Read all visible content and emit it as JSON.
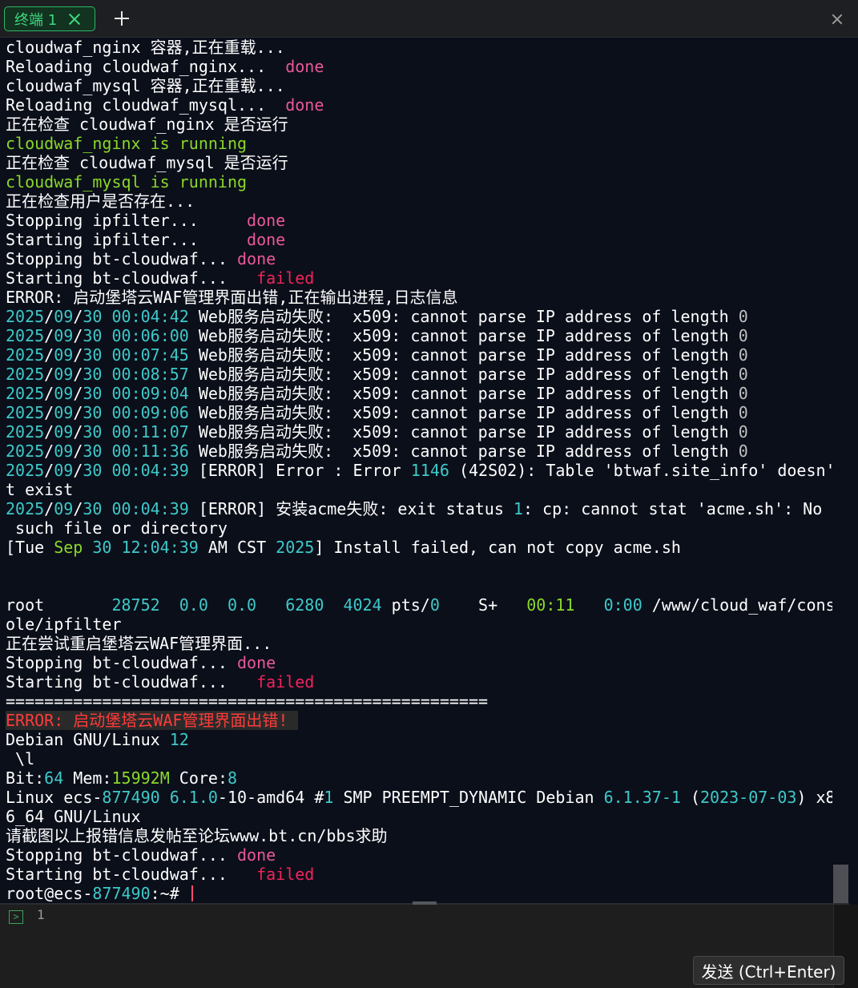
{
  "colors": {
    "default": "#ffffff",
    "done": "#e8589a",
    "failed": "#f0245a",
    "ok_green": "#8ad82a",
    "cyan": "#3ec9c9",
    "gray": "#bfbfbf",
    "red": "#ff3b3b"
  },
  "tabbar": {
    "tab_label": "终端 1",
    "close_icon": "close-icon",
    "add_icon": "plus-icon",
    "window_close_icon": "close-icon"
  },
  "terminal": {
    "lines": [
      [
        [
          "cloudwaf_nginx 容器,正在重载...",
          "default"
        ]
      ],
      [
        [
          "Reloading cloudwaf_nginx...  ",
          "default"
        ],
        [
          "done",
          "done"
        ]
      ],
      [
        [
          "cloudwaf_mysql 容器,正在重载...",
          "default"
        ]
      ],
      [
        [
          "Reloading cloudwaf_mysql...  ",
          "default"
        ],
        [
          "done",
          "done"
        ]
      ],
      [
        [
          "正在检查 cloudwaf_nginx 是否运行",
          "default"
        ]
      ],
      [
        [
          "cloudwaf_nginx is running",
          "ok_green"
        ]
      ],
      [
        [
          "正在检查 cloudwaf_mysql 是否运行",
          "default"
        ]
      ],
      [
        [
          "cloudwaf_mysql is running",
          "ok_green"
        ]
      ],
      [
        [
          "正在检查用户是否存在...",
          "default"
        ]
      ],
      [
        [
          "Stopping ipfilter...     ",
          "default"
        ],
        [
          "done",
          "done"
        ]
      ],
      [
        [
          "Starting ipfilter...     ",
          "default"
        ],
        [
          "done",
          "done"
        ]
      ],
      [
        [
          "Stopping bt-cloudwaf... ",
          "default"
        ],
        [
          "done",
          "done"
        ]
      ],
      [
        [
          "Starting bt-cloudwaf...   ",
          "default"
        ],
        [
          "failed",
          "failed"
        ]
      ],
      [
        [
          "ERROR: 启动堡塔云WAF管理界面出错,正在输出进程,日志信息",
          "default"
        ]
      ],
      [
        [
          "2025",
          "cyan"
        ],
        [
          "/",
          "default"
        ],
        [
          "09",
          "cyan"
        ],
        [
          "/",
          "default"
        ],
        [
          "30 00:04:42",
          "cyan"
        ],
        [
          " Web服务启动失败:  x509: cannot parse IP address of length ",
          "default"
        ],
        [
          "0",
          "gray"
        ]
      ],
      [
        [
          "2025",
          "cyan"
        ],
        [
          "/",
          "default"
        ],
        [
          "09",
          "cyan"
        ],
        [
          "/",
          "default"
        ],
        [
          "30 00:06:00",
          "cyan"
        ],
        [
          " Web服务启动失败:  x509: cannot parse IP address of length ",
          "default"
        ],
        [
          "0",
          "gray"
        ]
      ],
      [
        [
          "2025",
          "cyan"
        ],
        [
          "/",
          "default"
        ],
        [
          "09",
          "cyan"
        ],
        [
          "/",
          "default"
        ],
        [
          "30 00:07:45",
          "cyan"
        ],
        [
          " Web服务启动失败:  x509: cannot parse IP address of length ",
          "default"
        ],
        [
          "0",
          "gray"
        ]
      ],
      [
        [
          "2025",
          "cyan"
        ],
        [
          "/",
          "default"
        ],
        [
          "09",
          "cyan"
        ],
        [
          "/",
          "default"
        ],
        [
          "30 00:08:57",
          "cyan"
        ],
        [
          " Web服务启动失败:  x509: cannot parse IP address of length ",
          "default"
        ],
        [
          "0",
          "gray"
        ]
      ],
      [
        [
          "2025",
          "cyan"
        ],
        [
          "/",
          "default"
        ],
        [
          "09",
          "cyan"
        ],
        [
          "/",
          "default"
        ],
        [
          "30 00:09:04",
          "cyan"
        ],
        [
          " Web服务启动失败:  x509: cannot parse IP address of length ",
          "default"
        ],
        [
          "0",
          "gray"
        ]
      ],
      [
        [
          "2025",
          "cyan"
        ],
        [
          "/",
          "default"
        ],
        [
          "09",
          "cyan"
        ],
        [
          "/",
          "default"
        ],
        [
          "30 00:09:06",
          "cyan"
        ],
        [
          " Web服务启动失败:  x509: cannot parse IP address of length ",
          "default"
        ],
        [
          "0",
          "gray"
        ]
      ],
      [
        [
          "2025",
          "cyan"
        ],
        [
          "/",
          "default"
        ],
        [
          "09",
          "cyan"
        ],
        [
          "/",
          "default"
        ],
        [
          "30 00:11:07",
          "cyan"
        ],
        [
          " Web服务启动失败:  x509: cannot parse IP address of length ",
          "default"
        ],
        [
          "0",
          "gray"
        ]
      ],
      [
        [
          "2025",
          "cyan"
        ],
        [
          "/",
          "default"
        ],
        [
          "09",
          "cyan"
        ],
        [
          "/",
          "default"
        ],
        [
          "30 00:11:36",
          "cyan"
        ],
        [
          " Web服务启动失败:  x509: cannot parse IP address of length ",
          "default"
        ],
        [
          "0",
          "gray"
        ]
      ],
      [
        [
          "2025",
          "cyan"
        ],
        [
          "/",
          "default"
        ],
        [
          "09",
          "cyan"
        ],
        [
          "/",
          "default"
        ],
        [
          "30 00:04:39",
          "cyan"
        ],
        [
          " [ERROR] Error : Error ",
          "default"
        ],
        [
          "1146",
          "cyan"
        ],
        [
          " (42S02): Table 'btwaf.site_info' doesn'",
          "default"
        ]
      ],
      [
        [
          "t exist",
          "default"
        ]
      ],
      [
        [
          "2025",
          "cyan"
        ],
        [
          "/",
          "default"
        ],
        [
          "09",
          "cyan"
        ],
        [
          "/",
          "default"
        ],
        [
          "30 00:04:39",
          "cyan"
        ],
        [
          " [ERROR] 安装acme失败: exit status ",
          "default"
        ],
        [
          "1",
          "cyan"
        ],
        [
          ": cp: cannot stat 'acme.sh': No",
          "default"
        ]
      ],
      [
        [
          " such file or directory",
          "default"
        ]
      ],
      [
        [
          "[Tue ",
          "default"
        ],
        [
          "Sep",
          "ok_green"
        ],
        [
          " ",
          "default"
        ],
        [
          "30 12:04:39",
          "cyan"
        ],
        [
          " AM CST ",
          "default"
        ],
        [
          "2025",
          "cyan"
        ],
        [
          "] Install failed, can not copy acme.sh",
          "default"
        ]
      ],
      [],
      [],
      [
        [
          "root       ",
          "default"
        ],
        [
          "28752  0.0  0.0   6280  4024",
          "cyan"
        ],
        [
          " pts/",
          "default"
        ],
        [
          "0",
          "cyan"
        ],
        [
          "    S+   ",
          "default"
        ],
        [
          "00:11",
          "ok_green"
        ],
        [
          "   ",
          "default"
        ],
        [
          "0:00",
          "cyan"
        ],
        [
          " /www/cloud_waf/cons",
          "default"
        ]
      ],
      [
        [
          "ole/ipfilter",
          "default"
        ]
      ],
      [
        [
          "正在尝试重启堡塔云WAF管理界面...",
          "default"
        ]
      ],
      [
        [
          "Stopping bt-cloudwaf... ",
          "default"
        ],
        [
          "done",
          "done"
        ]
      ],
      [
        [
          "Starting bt-cloudwaf...   ",
          "default"
        ],
        [
          "failed",
          "failed"
        ]
      ],
      [
        [
          "==================================================",
          "default"
        ]
      ],
      [
        [
          "ERROR: 启动堡塔云WAF管理界面出错! ",
          "red",
          true
        ]
      ],
      [
        [
          "Debian GNU/Linux ",
          "default"
        ],
        [
          "12",
          "cyan"
        ]
      ],
      [
        [
          " \\l",
          "default"
        ]
      ],
      [
        [
          "Bit:",
          "default"
        ],
        [
          "64",
          "cyan"
        ],
        [
          " Mem:",
          "default"
        ],
        [
          "15992M",
          "ok_green"
        ],
        [
          " Core:",
          "default"
        ],
        [
          "8",
          "cyan"
        ]
      ],
      [
        [
          "Linux ecs-",
          "default"
        ],
        [
          "877490 6.1.0",
          "cyan"
        ],
        [
          "-10-amd64 #",
          "default"
        ],
        [
          "1",
          "cyan"
        ],
        [
          " SMP PREEMPT_DYNAMIC Debian ",
          "default"
        ],
        [
          "6.1.37-1",
          "cyan"
        ],
        [
          " (",
          "default"
        ],
        [
          "2023-07-03",
          "cyan"
        ],
        [
          ") x8",
          "default"
        ]
      ],
      [
        [
          "6_64 GNU/Linux",
          "default"
        ]
      ],
      [
        [
          "请截图以上报错信息发帖至论坛www.bt.cn/bbs求助",
          "default"
        ]
      ],
      [
        [
          "Stopping bt-cloudwaf... ",
          "default"
        ],
        [
          "done",
          "done"
        ]
      ],
      [
        [
          "Starting bt-cloudwaf...   ",
          "default"
        ],
        [
          "failed",
          "failed"
        ]
      ],
      [
        [
          "root@ecs-",
          "default"
        ],
        [
          "877490",
          "cyan"
        ],
        [
          ":~# ",
          "default"
        ]
      ]
    ]
  },
  "input": {
    "icon": "terminal-icon",
    "icon_glyph": ">",
    "line_number": "1",
    "send_label": "发送 (Ctrl+Enter)"
  }
}
